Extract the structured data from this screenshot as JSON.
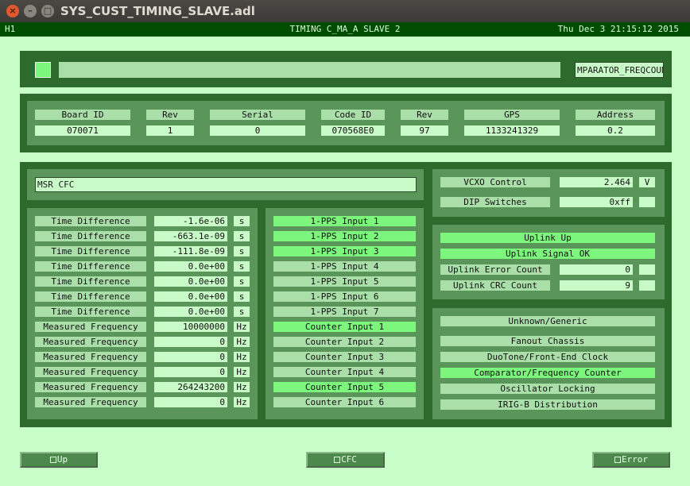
{
  "window": {
    "title": "SYS_CUST_TIMING_SLAVE.adl",
    "close": "×",
    "minimize": "–",
    "maximize": "□"
  },
  "header": {
    "left": "H1",
    "center": "TIMING C_MA_A SLAVE 2",
    "right": "Thu Dec  3 21:15:12 2015"
  },
  "top": {
    "indicator_color": "#7df67d",
    "right_label": "MPARATOR_FREQCOUNTI"
  },
  "info": {
    "columns": [
      {
        "label": "Board ID",
        "value": "070071"
      },
      {
        "label": "Rev",
        "value": "1"
      },
      {
        "label": "Serial",
        "value": "0"
      },
      {
        "label": "Code ID",
        "value": "070568E0"
      },
      {
        "label": "Rev",
        "value": "97"
      },
      {
        "label": "GPS",
        "value": "1133241329"
      },
      {
        "label": "Address",
        "value": "0.2"
      }
    ]
  },
  "msr_field": "MSR CFC",
  "measurements": [
    {
      "label": "Time Difference",
      "value": "-1.6e-06",
      "unit": "s"
    },
    {
      "label": "Time Difference",
      "value": "-663.1e-09",
      "unit": "s"
    },
    {
      "label": "Time Difference",
      "value": "-111.8e-09",
      "unit": "s"
    },
    {
      "label": "Time Difference",
      "value": "0.0e+00",
      "unit": "s"
    },
    {
      "label": "Time Difference",
      "value": "0.0e+00",
      "unit": "s"
    },
    {
      "label": "Time Difference",
      "value": "0.0e+00",
      "unit": "s"
    },
    {
      "label": "Time Difference",
      "value": "0.0e+00",
      "unit": "s"
    },
    {
      "label": "Measured Frequency",
      "value": "10000000",
      "unit": "Hz"
    },
    {
      "label": "Measured Frequency",
      "value": "0",
      "unit": "Hz"
    },
    {
      "label": "Measured Frequency",
      "value": "0",
      "unit": "Hz"
    },
    {
      "label": "Measured Frequency",
      "value": "0",
      "unit": "Hz"
    },
    {
      "label": "Measured Frequency",
      "value": "264243200",
      "unit": "Hz"
    },
    {
      "label": "Measured Frequency",
      "value": "0",
      "unit": "Hz"
    }
  ],
  "inputs": [
    {
      "label": "1-PPS Input 1",
      "active": true
    },
    {
      "label": "1-PPS Input 2",
      "active": true
    },
    {
      "label": "1-PPS Input 3",
      "active": true
    },
    {
      "label": "1-PPS Input 4",
      "active": false
    },
    {
      "label": "1-PPS Input 5",
      "active": false
    },
    {
      "label": "1-PPS Input 6",
      "active": false
    },
    {
      "label": "1-PPS Input 7",
      "active": false
    },
    {
      "label": "Counter Input 1",
      "active": true
    },
    {
      "label": "Counter Input 2",
      "active": false
    },
    {
      "label": "Counter Input 3",
      "active": false
    },
    {
      "label": "Counter Input 4",
      "active": false
    },
    {
      "label": "Counter Input 5",
      "active": true
    },
    {
      "label": "Counter Input 6",
      "active": false
    }
  ],
  "vcxo": {
    "label": "VCXO Control",
    "value": "2.464",
    "unit": "V"
  },
  "dip": {
    "label": "DIP Switches",
    "value": "0xff",
    "unit": ""
  },
  "uplink": {
    "up": "Uplink Up",
    "signal_ok": "Uplink Signal OK",
    "error_label": "Uplink Error Count",
    "error_value": "0",
    "crc_label": "Uplink CRC Count",
    "crc_value": "9"
  },
  "types": [
    {
      "label": "Unknown/Generic",
      "active": false
    },
    {
      "label": "Fanout Chassis",
      "active": false
    },
    {
      "label": "DuoTone/Front-End Clock",
      "active": false
    },
    {
      "label": "Comparator/Frequency Counter",
      "active": true
    },
    {
      "label": "Oscillator Locking",
      "active": false
    },
    {
      "label": "IRIG-B Distribution",
      "active": false
    }
  ],
  "buttons": {
    "up": "Up",
    "cfc": "CFC",
    "error": "Error"
  }
}
